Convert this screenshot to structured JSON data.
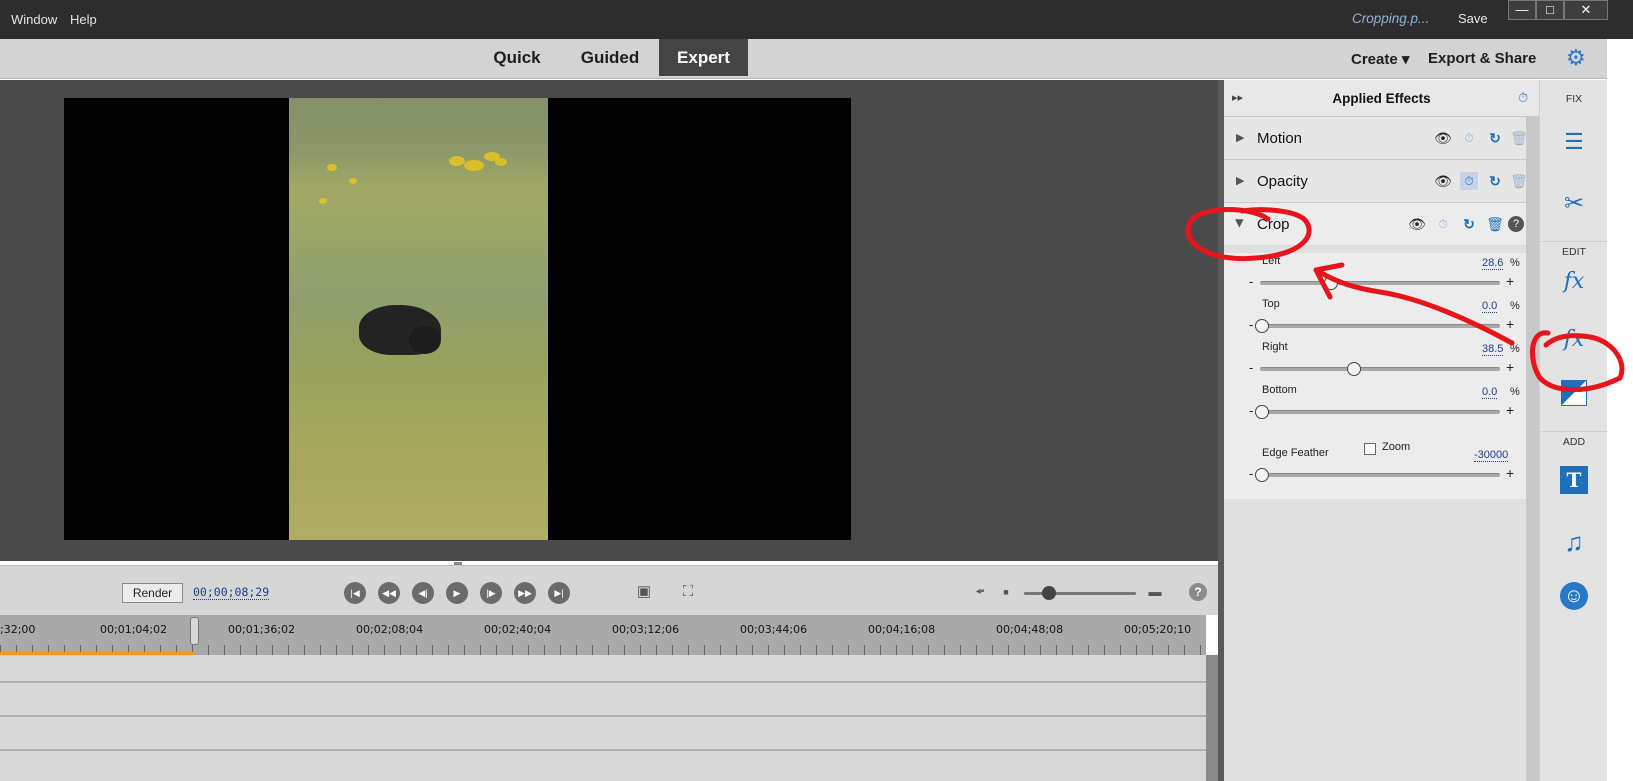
{
  "menubar": {
    "items": [
      "Window",
      "Help"
    ],
    "filename": "Cropping.p...",
    "save": "Save",
    "window_controls": {
      "minimize": "—",
      "maximize": "□",
      "close": "✕"
    }
  },
  "modes": {
    "tabs": [
      "Quick",
      "Guided",
      "Expert"
    ],
    "active": "Expert",
    "create": "Create ▾",
    "export": "Export & Share"
  },
  "transport": {
    "render": "Render",
    "timecode": "00;00;08;29"
  },
  "timeline": {
    "ticks": [
      ";32;00",
      "00;01;04;02",
      "00;01;36;02",
      "00;02;08;04",
      "00;02;40;04",
      "00;03;12;06",
      "00;03;44;06",
      "00;04;16;08",
      "00;04;48;08",
      "00;05;20;10"
    ]
  },
  "panel": {
    "title": "Applied Effects",
    "effects": [
      {
        "name": "Motion"
      },
      {
        "name": "Opacity"
      },
      {
        "name": "Crop"
      }
    ],
    "crop_params": [
      {
        "label": "Left",
        "value": "28.6",
        "unit": "%",
        "fraction": 0.286
      },
      {
        "label": "Top",
        "value": "0.0",
        "unit": "%",
        "fraction": 0.0
      },
      {
        "label": "Right",
        "value": "38.5",
        "unit": "%",
        "fraction": 0.385
      },
      {
        "label": "Bottom",
        "value": "0.0",
        "unit": "%",
        "fraction": 0.0
      }
    ],
    "zoom_label": "Zoom",
    "edge_feather": {
      "label": "Edge Feather",
      "value": "-30000",
      "fraction": 0.0
    },
    "minus": "-",
    "plus": "+"
  },
  "toolbar": {
    "fix": "FIX",
    "edit": "EDIT",
    "add": "ADD"
  },
  "colors": {
    "accent": "#2a79c7",
    "annotation": "#e8141c",
    "timeline_progress": "#f19a1d"
  }
}
